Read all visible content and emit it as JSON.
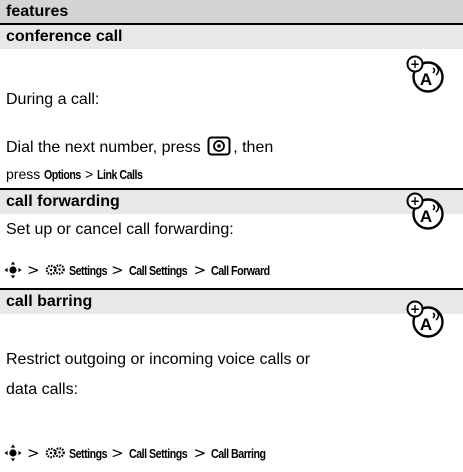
{
  "header": {
    "title": "features"
  },
  "sections": [
    {
      "title": "conference call",
      "intro": "During a call:",
      "line1_pre": "Dial the next number, press",
      "line1_post": ", then",
      "line2_pre": "press",
      "menu_a": "Options",
      "sep": ">",
      "menu_b": "Link Calls"
    },
    {
      "title": "call forwarding",
      "intro": "Set up or cancel call forwarding:",
      "path": [
        "Settings",
        "Call Settings",
        "Call Forward"
      ]
    },
    {
      "title": "call barring",
      "intro_line1": "Restrict outgoing or incoming voice calls or",
      "intro_line2": "data calls:",
      "path": [
        "Settings",
        "Call Settings",
        "Call Barring"
      ]
    }
  ],
  "icons": {
    "feature": "network-feature-icon",
    "nav": "navigation-key-icon",
    "settings": "settings-gears-icon",
    "send": "send-key-icon"
  }
}
